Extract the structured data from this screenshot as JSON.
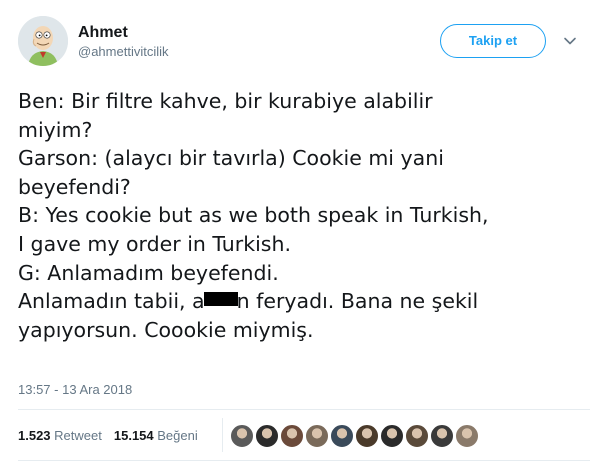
{
  "user": {
    "display_name": "Ahmet",
    "handle": "@ahmettivitcilik",
    "avatar_icon": "cartoon-avatar-icon"
  },
  "follow_button": {
    "label": "Takip et",
    "color": "#1da1f2"
  },
  "menu_icon": "chevron-down-icon",
  "tweet": {
    "lines": [
      "Ben: Bir filtre kahve, bir kurabiye alabilir",
      "miyim?",
      "Garson: (alaycı bir tavırla) Cookie mi yani",
      "beyefendi?",
      "B: Yes cookie but as we both speak in Turkish,",
      "I gave my order in Turkish.",
      "G: Anlamadım beyefendi."
    ],
    "line8_before": "Anlamadın tabii, a",
    "line8_after": "n feryadı. Bana ne şekil",
    "line9": "yapıyorsun. Coookie miymiş."
  },
  "timestamp": "13:57 - 13 Ara 2018",
  "stats": {
    "retweets_count": "1.523",
    "retweets_label": "Retweet",
    "likes_count": "15.154",
    "likes_label": "Beğeni"
  },
  "likers": [
    "#5a5a5a",
    "#2b2b2b",
    "#6b4a3a",
    "#7a6a5a",
    "#3a4a5a",
    "#4a3a2a",
    "#2a2a2a",
    "#5a4a3a",
    "#3a3a3a",
    "#8a7a6a"
  ]
}
